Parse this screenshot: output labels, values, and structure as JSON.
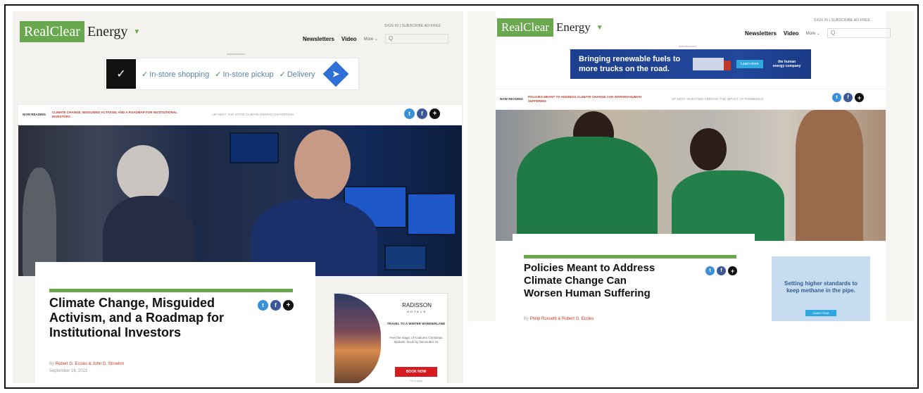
{
  "left": {
    "logo": {
      "real_clear": "RealClear",
      "energy": "Energy"
    },
    "top_links": "SIGN IN  |  SUBSCRIBE AD-FREE",
    "nav": {
      "newsletters": "Newsletters",
      "video": "Video",
      "more": "More ⌄",
      "search_placeholder": "Q"
    },
    "ad_label": "Advertisement",
    "ad_nike": {
      "features": [
        "In-store shopping",
        "In-store pickup",
        "Delivery"
      ]
    },
    "now_reading": {
      "label": "NOW READING",
      "current": "CLIMATE CHANGE, MISGUIDED ACTIVISM, AND A ROADMAP FOR INSTITUTIONAL INVESTORS",
      "next": "UP NEXT: THE STATE CLIMATE ENERGY DISTORTION"
    },
    "article": {
      "headline": "Climate Change, Misguided Activism, and a Roadmap for Institutional Investors",
      "by": "By",
      "authors": "Robert G. Eccles & John D. Stroehm",
      "date": "September 16, 2022"
    },
    "ad_radisson": {
      "brand": "RADISSON",
      "brand_sub": "HOTELS",
      "heading": "TRAVEL TO A WINTER WONDERLAND",
      "text": "Feel the magic of Krakow's Christmas Markets. Book by December 31",
      "button": "BOOK NOW",
      "terms": "T&Cs apply"
    }
  },
  "right": {
    "logo": {
      "real_clear": "RealClear",
      "energy": "Energy"
    },
    "top_links": "SIGN IN  |  SUBSCRIBE AD-FREE",
    "nav": {
      "newsletters": "Newsletters",
      "video": "Video",
      "more": "More ⌄",
      "search_placeholder": "Q"
    },
    "ad_label": "Advertisement",
    "ad_truck": {
      "message": "Bringing renewable fuels to more trucks on the road.",
      "button": "Learn more",
      "brand": "the human energy company"
    },
    "now_reading": {
      "label": "NOW READING",
      "current": "POLICIES MEANT TO ADDRESS CLIMATE CHANGE CAN WORSEN HUMAN SUFFERING",
      "next": "UP NEXT: INVESTING ABROAD: THE IMPACT OF PANDEMICS"
    },
    "article": {
      "headline": "Policies Meant to Address Climate Change Can Worsen Human Suffering",
      "by": "By",
      "authors": "Philip Rossetti & Robert G. Eccles"
    },
    "ad_methane": {
      "text": "Setting higher standards to keep methane in the pipe.",
      "button": "Learn more"
    }
  },
  "icons": {
    "twitter": "twitter-icon",
    "facebook": "facebook-icon",
    "plus": "plus-icon",
    "check": "check-icon",
    "arrow": "arrow-icon",
    "nike": "nike-swoosh-icon"
  },
  "colors": {
    "brand_green": "#6aa84f",
    "author_red": "#c0392b",
    "twitter": "#3a8fd9",
    "facebook": "#3b5998"
  }
}
